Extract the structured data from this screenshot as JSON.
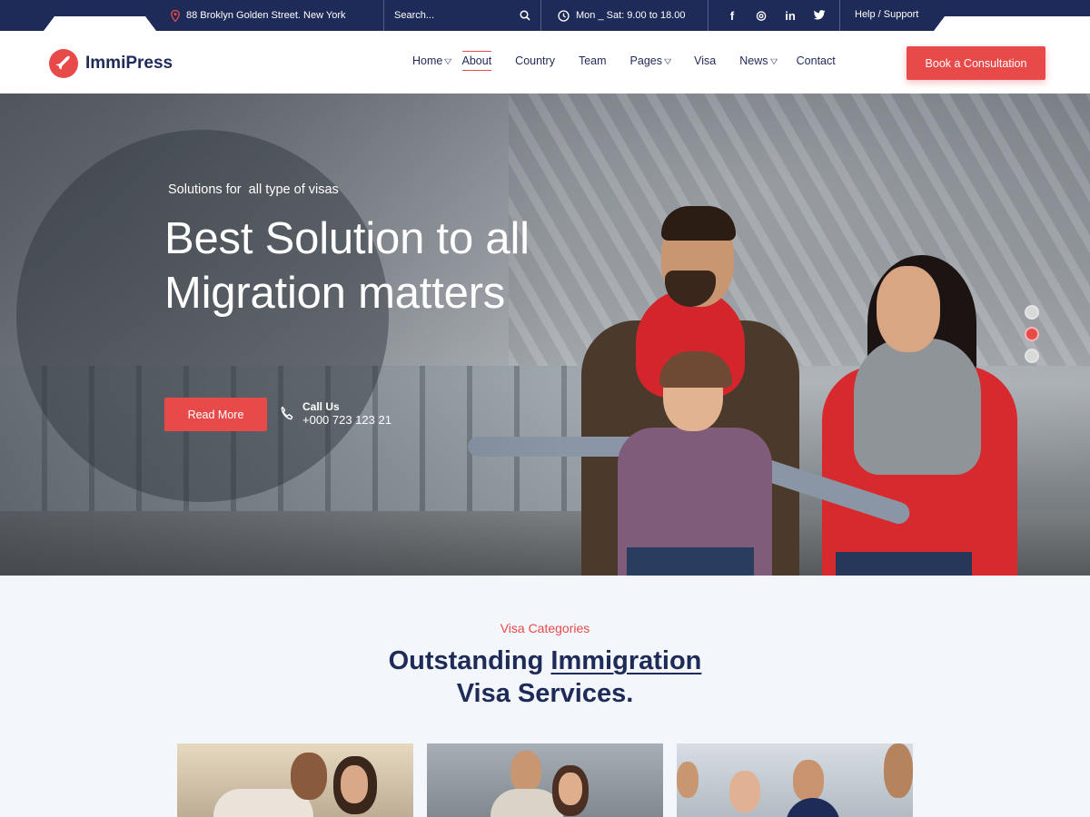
{
  "topbar": {
    "address": "88 Broklyn Golden Street. New York",
    "search_placeholder": "Search...",
    "hours": "Mon _ Sat: 9.00 to 18.00",
    "social": [
      {
        "name": "facebook-icon",
        "glyph": "f"
      },
      {
        "name": "dribbble-icon",
        "glyph": "⊛"
      },
      {
        "name": "linkedin-icon",
        "glyph": "in"
      },
      {
        "name": "twitter-icon",
        "glyph": "🐦"
      }
    ],
    "help": "Help / Support"
  },
  "header": {
    "logo_text": "ImmiPress",
    "nav": [
      {
        "label": "Home",
        "dropdown": true
      },
      {
        "label": "About",
        "active": true
      },
      {
        "label": "Country"
      },
      {
        "label": "Team"
      },
      {
        "label": "Pages",
        "dropdown": true
      },
      {
        "label": "Visa"
      },
      {
        "label": "News",
        "dropdown": true
      },
      {
        "label": "Contact"
      }
    ],
    "cta": "Book a Consultation"
  },
  "hero": {
    "subtitle": "Solutions for  all type of visas",
    "title": "Best Solution to all Migration matters",
    "read_more": "Read More",
    "call_label": "Call Us",
    "call_number": "+000 723 123 21",
    "slides": 3,
    "active_slide": 2
  },
  "visa_section": {
    "eyebrow": "Visa Categories",
    "title_before": "Outstanding ",
    "title_highlight": "Immigration",
    "title_after": "Visa Services."
  },
  "colors": {
    "accent": "#e84a4a",
    "navy": "#1e2a57",
    "section_bg": "#f3f6fb"
  }
}
